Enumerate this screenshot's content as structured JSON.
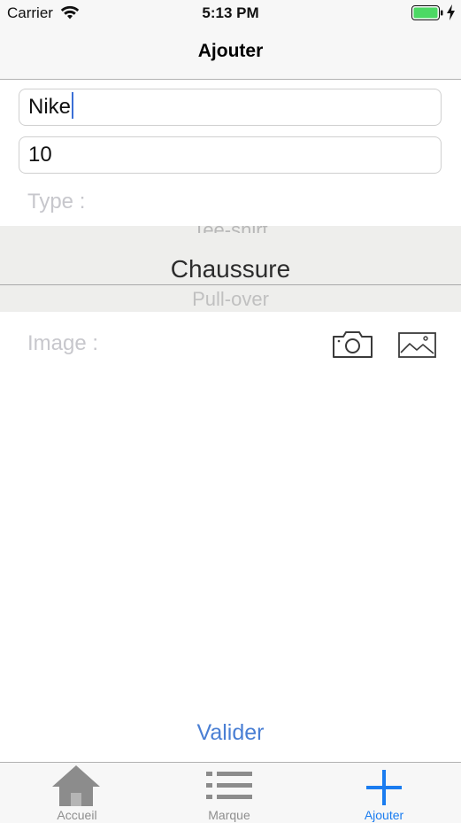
{
  "status_bar": {
    "carrier": "Carrier",
    "time": "5:13 PM",
    "battery_color": "#4cd964"
  },
  "nav": {
    "title": "Ajouter"
  },
  "form": {
    "name_value": "Nike",
    "quantity_value": "10",
    "type_label": "Type :",
    "image_label": "Image :",
    "picker": {
      "above": "Tee-shirt",
      "selected": "Chaussure",
      "below": "Pull-over"
    },
    "camera_icon": "camera-icon",
    "gallery_icon": "photo-library-icon",
    "submit_label": "Valider",
    "accent_color": "#4a7fd4"
  },
  "tab_bar": {
    "active_color": "#1a7cf0",
    "inactive_color": "#8e8e8e",
    "tabs": [
      {
        "label": "Accueil",
        "icon": "home-icon"
      },
      {
        "label": "Marque",
        "icon": "list-icon"
      },
      {
        "label": "Ajouter",
        "icon": "plus-icon"
      }
    ]
  }
}
